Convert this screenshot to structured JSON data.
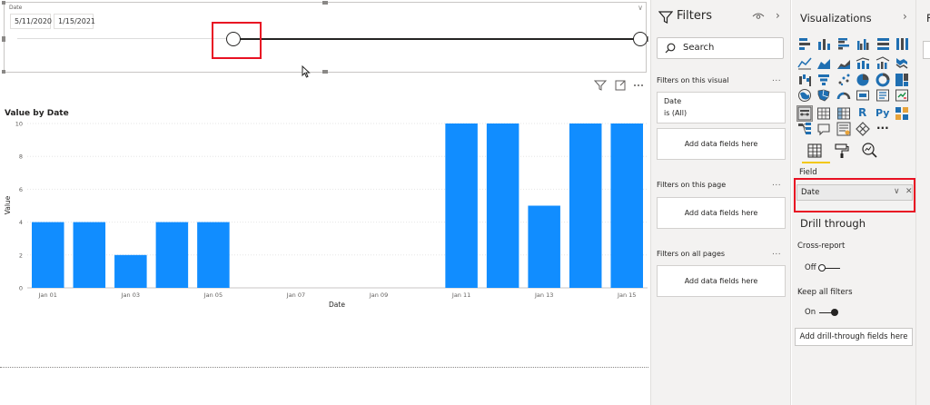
{
  "slicer": {
    "title": "Date",
    "start_date": "5/11/2020",
    "end_date": "1/15/2021"
  },
  "chart_data": {
    "type": "bar",
    "title": "Value by Date",
    "xlabel": "Date",
    "ylabel": "Value",
    "ylim": [
      0,
      10
    ],
    "yticks": [
      0,
      2,
      4,
      6,
      8,
      10
    ],
    "categories": [
      "Jan 01",
      "Jan 02",
      "Jan 03",
      "Jan 04",
      "Jan 05",
      "Jan 06",
      "Jan 07",
      "Jan 08",
      "Jan 09",
      "Jan 10",
      "Jan 11",
      "Jan 12",
      "Jan 13",
      "Jan 14",
      "Jan 15"
    ],
    "tick_labels": [
      "Jan 01",
      "",
      "Jan 03",
      "",
      "Jan 05",
      "",
      "Jan 07",
      "",
      "Jan 09",
      "",
      "Jan 11",
      "",
      "Jan 13",
      "",
      "Jan 15"
    ],
    "values": [
      4,
      4,
      2,
      4,
      4,
      null,
      null,
      null,
      null,
      null,
      10,
      10,
      5,
      10,
      10
    ],
    "bar_color": "#118dff",
    "grid": true
  },
  "filters_pane": {
    "title": "Filters",
    "search_placeholder": "Search",
    "on_visual_label": "Filters on this visual",
    "visual_filter_field": "Date",
    "visual_filter_state": "is (All)",
    "add_fields_visual": "Add data fields here",
    "on_page_label": "Filters on this page",
    "add_fields_page": "Add data fields here",
    "all_pages_label": "Filters on all pages",
    "add_fields_all": "Add data fields here",
    "more": "..."
  },
  "viz_pane": {
    "title": "Visualizations",
    "field_label": "Field",
    "field_value": "Date",
    "drill_title": "Drill through",
    "cross_report_label": "Cross-report",
    "cross_report_value": "Off",
    "keep_filters_label": "Keep all filters",
    "keep_filters_value": "On",
    "add_drill_label": "Add drill-through fields here",
    "icons": [
      "stacked-bar-icon",
      "stacked-column-icon",
      "clustered-bar-icon",
      "clustered-column-icon",
      "100-stacked-bar-icon",
      "100-stacked-column-icon",
      "line-chart-icon",
      "area-chart-icon",
      "stacked-area-icon",
      "line-column-icon",
      "line-clustered-column-icon",
      "ribbon-chart-icon",
      "waterfall-icon",
      "funnel-icon",
      "scatter-icon",
      "pie-icon",
      "donut-icon",
      "treemap-icon",
      "map-icon",
      "filled-map-icon",
      "gauge-icon",
      "card-icon",
      "multirow-card-icon",
      "kpi-icon",
      "slicer-icon",
      "table-icon",
      "matrix-icon",
      "r-visual-icon",
      "python-visual-icon",
      "key-influencers-icon",
      "decomposition-tree-icon",
      "qa-icon",
      "smart-narrative-icon",
      "power-apps-icon",
      "more-visuals-icon"
    ],
    "r_glyph": "R",
    "py_glyph": "Py",
    "more_glyph": "···"
  },
  "fields_pane": {
    "title_initial": "F"
  },
  "colors": {
    "bar": "#118dff",
    "highlight": "#e81123",
    "pane_bg": "#f3f2f1",
    "accent_yellow": "#f2c80f"
  }
}
